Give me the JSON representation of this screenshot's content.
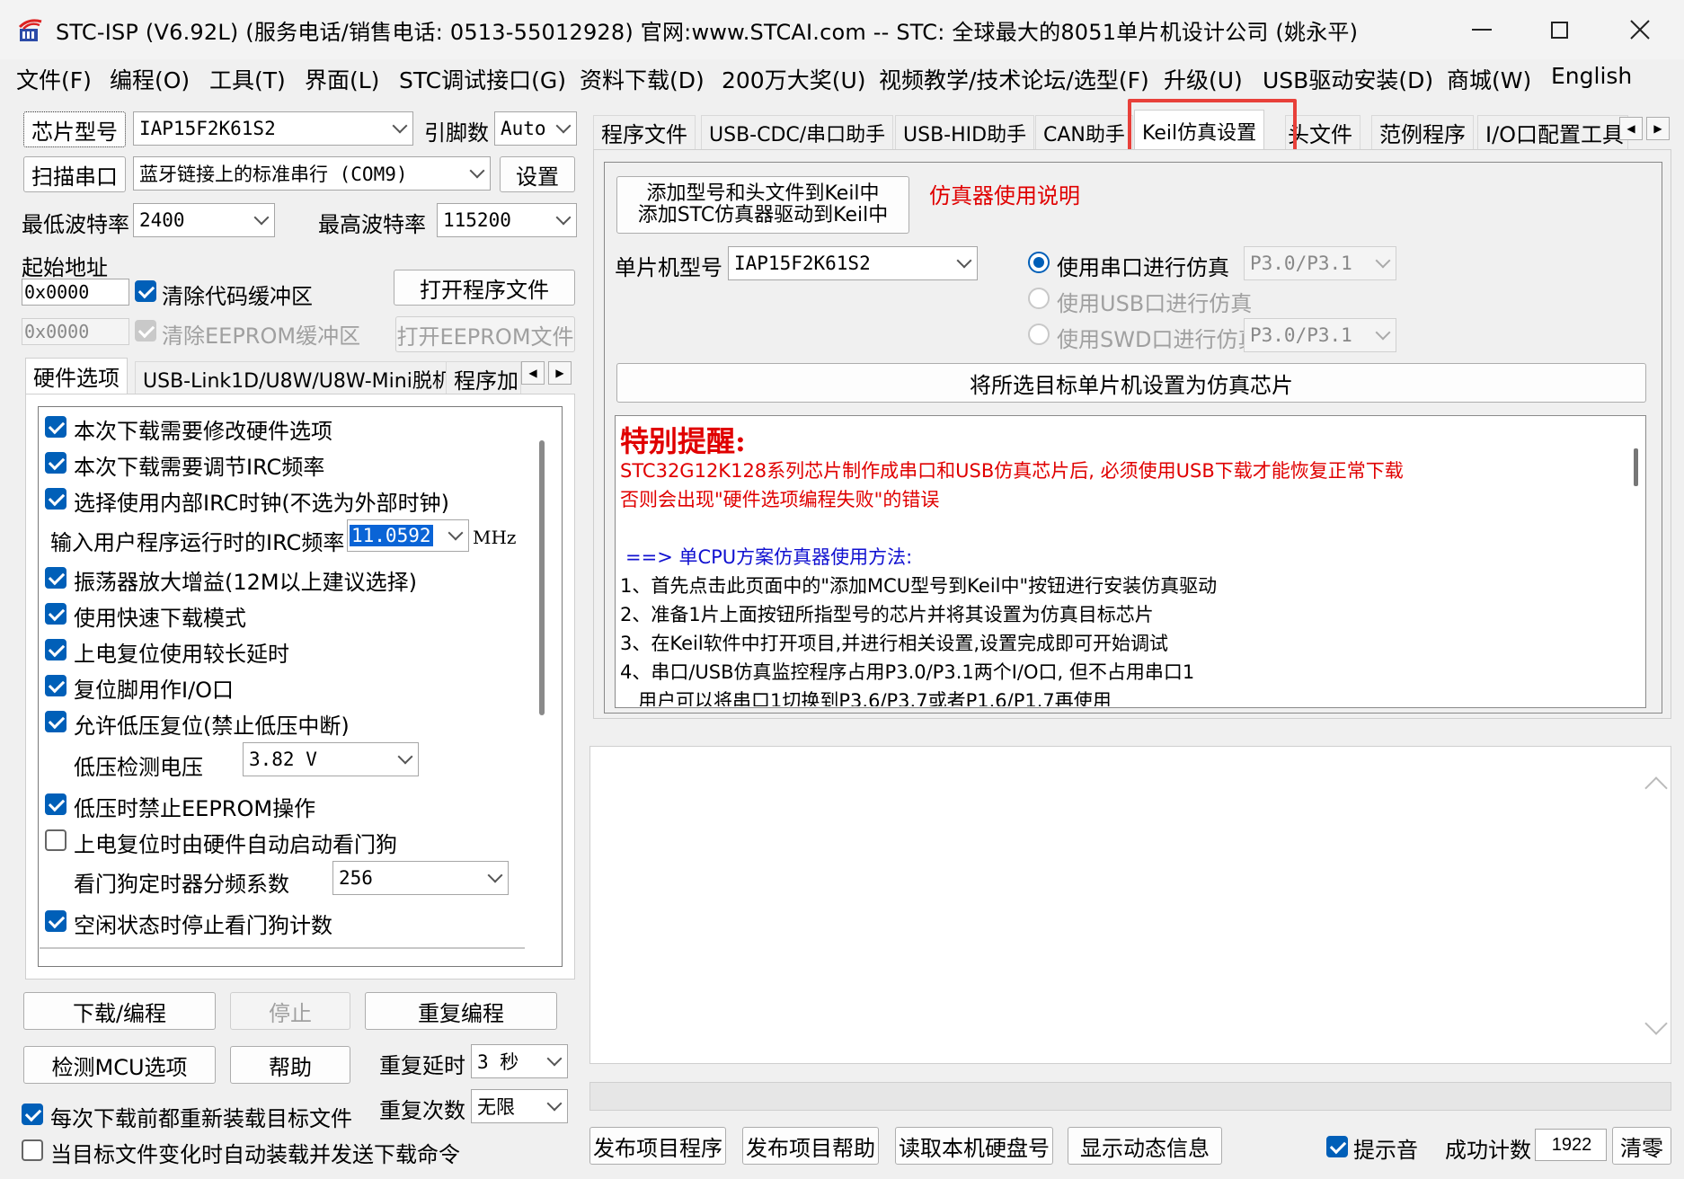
{
  "window": {
    "title": "STC-ISP (V6.92L) (服务电话/销售电话: 0513-55012928) 官网:www.STCAI.com  -- STC: 全球最大的8051单片机设计公司 (姚永平)"
  },
  "menu": [
    "文件(F)",
    "编程(O)",
    "工具(T)",
    "界面(L)",
    "STC调试接口(G)",
    "资料下载(D)",
    "200万大奖(U)",
    "视频教学/技术论坛/选型(F)",
    "升级(U)",
    "USB驱动安装(D)",
    "商城(W)",
    "English"
  ],
  "left": {
    "chip_label": "芯片型号",
    "chip_value": "IAP15F2K61S2",
    "pin_label": "引脚数",
    "pin_value": "Auto",
    "scan_label": "扫描串口",
    "port_value": "蓝牙链接上的标准串行 (COM9)",
    "settings_label": "设置",
    "min_baud_label": "最低波特率",
    "min_baud_value": "2400",
    "max_baud_label": "最高波特率",
    "max_baud_value": "115200",
    "start_addr_label": "起始地址",
    "addr1": "0x0000",
    "clear_code_label": "清除代码缓冲区",
    "open_program_label": "打开程序文件",
    "addr2": "0x0000",
    "clear_eeprom_label": "清除EEPROM缓冲区",
    "open_eeprom_label": "打开EEPROM文件",
    "tabs": [
      "硬件选项",
      "USB-Link1D/U8W/U8W-Mini脱机",
      "程序加"
    ],
    "options": [
      {
        "label": "本次下载需要修改硬件选项",
        "checked": true
      },
      {
        "label": "本次下载需要调节IRC频率",
        "checked": true
      },
      {
        "label": "选择使用内部IRC时钟(不选为外部时钟)",
        "checked": true
      }
    ],
    "irc_label": "输入用户程序运行时的IRC频率",
    "irc_value": "11.0592",
    "irc_unit": "MHz",
    "options2": [
      {
        "label": "振荡器放大增益(12M以上建议选择)",
        "checked": true
      },
      {
        "label": "使用快速下载模式",
        "checked": true
      },
      {
        "label": "上电复位使用较长延时",
        "checked": true
      },
      {
        "label": "复位脚用作I/O口",
        "checked": true
      },
      {
        "label": "允许低压复位(禁止低压中断)",
        "checked": true
      }
    ],
    "lv_label": "低压检测电压",
    "lv_value": "3.82 V",
    "opt_eeprom_label": "低压时禁止EEPROM操作",
    "opt_wdt_label": "上电复位时由硬件自动启动看门狗",
    "wdt_div_label": "看门狗定时器分频系数",
    "wdt_div_value": "256",
    "opt_idle_label": "空闲状态时停止看门狗计数",
    "download_label": "下载/编程",
    "stop_label": "停止",
    "reprogram_label": "重复编程",
    "detect_label": "检测MCU选项",
    "help_label": "帮助",
    "repeat_delay_label": "重复延时",
    "repeat_delay_value": "3 秒",
    "repeat_count_label": "重复次数",
    "repeat_count_value": "无限",
    "reload_label": "每次下载前都重新装载目标文件",
    "autoload_label": "当目标文件变化时自动装载并发送下载命令"
  },
  "right": {
    "tabs": [
      "程序文件",
      "USB-CDC/串口助手",
      "USB-HID助手",
      "CAN助手",
      "Keil仿真设置",
      "头文件",
      "范例程序",
      "I/O口配置工具"
    ],
    "add_button_line1": "添加型号和头文件到Keil中",
    "add_button_line2": "添加STC仿真器驱动到Keil中",
    "usage_link": "仿真器使用说明",
    "mcu_label": "单片机型号",
    "mcu_value": "IAP15F2K61S2",
    "radio_serial": "使用串口进行仿真",
    "serial_port_value": "P3.0/P3.1",
    "radio_usb": "使用USB口进行仿真",
    "radio_swd": "使用SWD口进行仿真",
    "swd_value": "P3.0/P3.1",
    "set_target_label": "将所选目标单片机设置为仿真芯片",
    "memo": {
      "heading": "特别提醒:",
      "warn1": "STC32G12K128系列芯片制作成串口和USB仿真芯片后, 必须使用USB下载才能恢复正常下载",
      "warn2": "否则会出现\"硬件选项编程失败\"的错误",
      "section": "==> 单CPU方案仿真器使用方法:",
      "step1": "1、首先点击此页面中的\"添加MCU型号到Keil中\"按钮进行安装仿真驱动",
      "step2": "2、准备1片上面按钮所指型号的芯片并将其设置为仿真目标芯片",
      "step3": "3、在Keil软件中打开项目,并进行相关设置,设置完成即可开始调试",
      "step4": "4、串口/USB仿真监控程序占用P3.0/P3.1两个I/O口, 但不占用串口1",
      "step5": "   用户可以将串口1切换到P3.6/P3.7或者P1.6/P1.7再使用"
    },
    "publish_prog_label": "发布项目程序",
    "publish_help_label": "发布项目帮助",
    "read_disk_label": "读取本机硬盘号",
    "show_dynamic_label": "显示动态信息",
    "beep_label": "提示音",
    "success_label": "成功计数",
    "success_value": "1922",
    "clear_label": "清零"
  },
  "colors": {
    "accent": "#005fb8",
    "highlight_box": "#e8403a",
    "warning_red": "#e00000",
    "info_blue": "#1010d0"
  }
}
